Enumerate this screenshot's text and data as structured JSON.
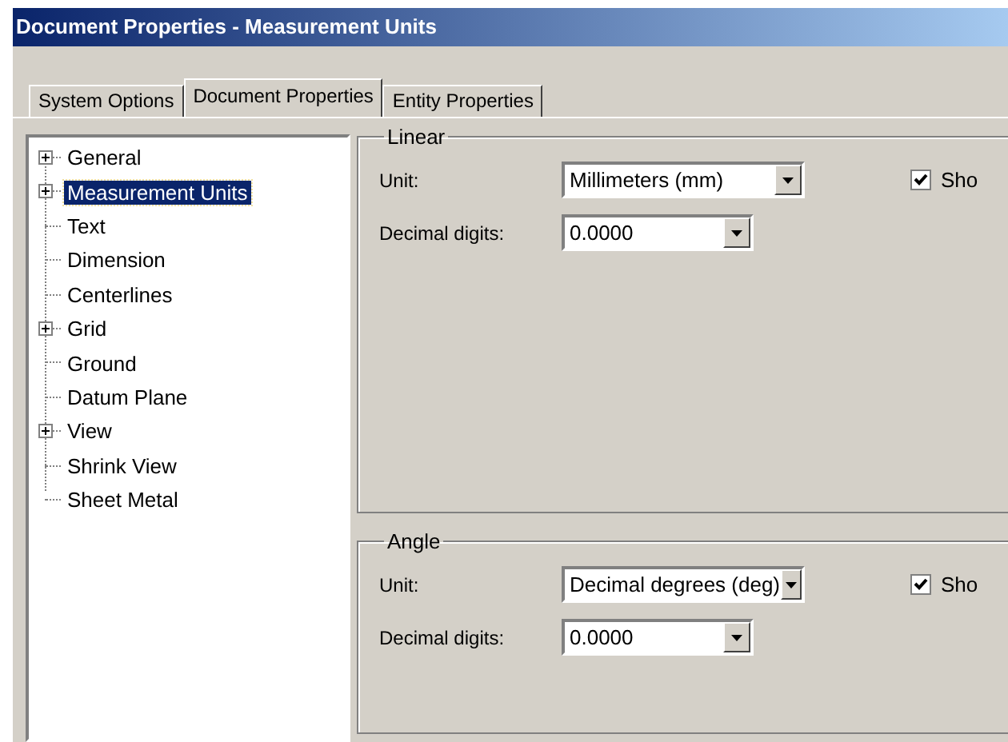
{
  "window": {
    "title": "Document Properties - Measurement Units"
  },
  "tabs": [
    {
      "label": "System Options",
      "selected": false
    },
    {
      "label": "Document Properties",
      "selected": true
    },
    {
      "label": "Entity Properties",
      "selected": false
    }
  ],
  "tree": {
    "items": [
      {
        "label": "General",
        "expandable": true,
        "selected": false
      },
      {
        "label": "Measurement Units",
        "expandable": true,
        "selected": true
      },
      {
        "label": "Text",
        "expandable": false,
        "selected": false
      },
      {
        "label": "Dimension",
        "expandable": false,
        "selected": false
      },
      {
        "label": "Centerlines",
        "expandable": false,
        "selected": false
      },
      {
        "label": "Grid",
        "expandable": true,
        "selected": false
      },
      {
        "label": "Ground",
        "expandable": false,
        "selected": false
      },
      {
        "label": "Datum Plane",
        "expandable": false,
        "selected": false
      },
      {
        "label": "View",
        "expandable": true,
        "selected": false
      },
      {
        "label": "Shrink View",
        "expandable": false,
        "selected": false
      },
      {
        "label": "Sheet Metal",
        "expandable": false,
        "selected": false
      }
    ]
  },
  "groups": [
    {
      "title": "Linear",
      "unit_label": "Unit:",
      "unit": "Millimeters (mm)",
      "show_checkbox": {
        "label": "Sho",
        "checked": true
      },
      "digits_label": "Decimal digits:",
      "digits": "0.0000"
    },
    {
      "title": "Angle",
      "unit_label": "Unit:",
      "unit": "Decimal degrees (deg)",
      "show_checkbox": {
        "label": "Sho",
        "checked": true
      },
      "digits_label": "Decimal digits:",
      "digits": "0.0000"
    }
  ]
}
